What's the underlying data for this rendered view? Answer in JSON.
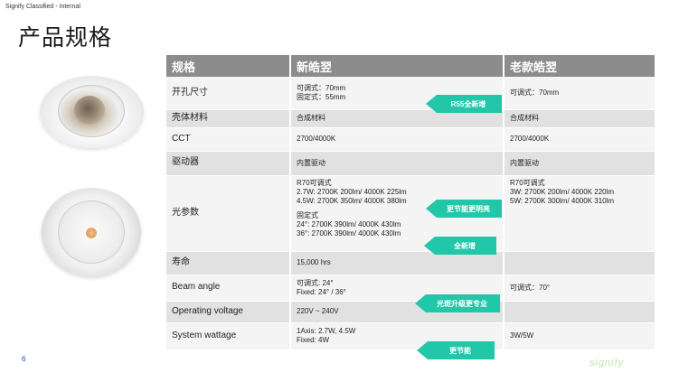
{
  "classification": "Signify Classified - Internal",
  "title": "产品规格",
  "page_number": "6",
  "table": {
    "headers": [
      "规格",
      "新皓翌",
      "老款皓翌"
    ],
    "rows": [
      {
        "label": "开孔尺寸",
        "new": [
          "可调式：70mm",
          "固定式：55mm"
        ],
        "old": [
          "可调式：70mm"
        ]
      },
      {
        "label": "壳体材料",
        "new": [
          "合成材料"
        ],
        "old": [
          "合成材料"
        ]
      },
      {
        "label": "CCT",
        "new": [
          "2700/4000K"
        ],
        "old": [
          "2700/4000K"
        ]
      },
      {
        "label": "驱动器",
        "new": [
          "内置驱动"
        ],
        "old": [
          "内置驱动"
        ]
      },
      {
        "label": "光参数",
        "new": [
          "R70可调式",
          "2.7W: 2700K 200lm/ 4000K 225lm",
          "4.5W: 2700K 350lm/ 4000K 380lm",
          "",
          "固定式",
          "24°: 2700K 390lm/ 4000K 430lm",
          "36°: 2700K 390lm/ 4000K 430lm"
        ],
        "old": [
          "R70可调式",
          "3W: 2700K 200lm/ 4000K 220lm",
          "5W: 2700K 300lm/ 4000K 310lm"
        ]
      },
      {
        "label": "寿命",
        "new": [
          "15,000 hrs"
        ],
        "old": []
      },
      {
        "label": "Beam angle",
        "new": [
          "可调式: 24°",
          "Fixed: 24° / 36°"
        ],
        "old": [
          "可调式：70°"
        ]
      },
      {
        "label": "Operating voltage",
        "new": [
          "220V ~ 240V"
        ],
        "old": []
      },
      {
        "label": "System wattage",
        "new": [
          "1Axis: 2.7W, 4.5W",
          "Fixed: 4W"
        ],
        "old": [
          "3W/5W"
        ]
      }
    ]
  },
  "callouts": {
    "c1": "R55全新增",
    "c2": "更节能更明亮",
    "c3": "全新增",
    "c4": "光斑升级更专业",
    "c5": "更节能"
  },
  "brand": "signify",
  "colors": {
    "header_bg": "#8c8c8c",
    "callout": "#22c7a9",
    "row_shade": "#e1e1e1"
  }
}
